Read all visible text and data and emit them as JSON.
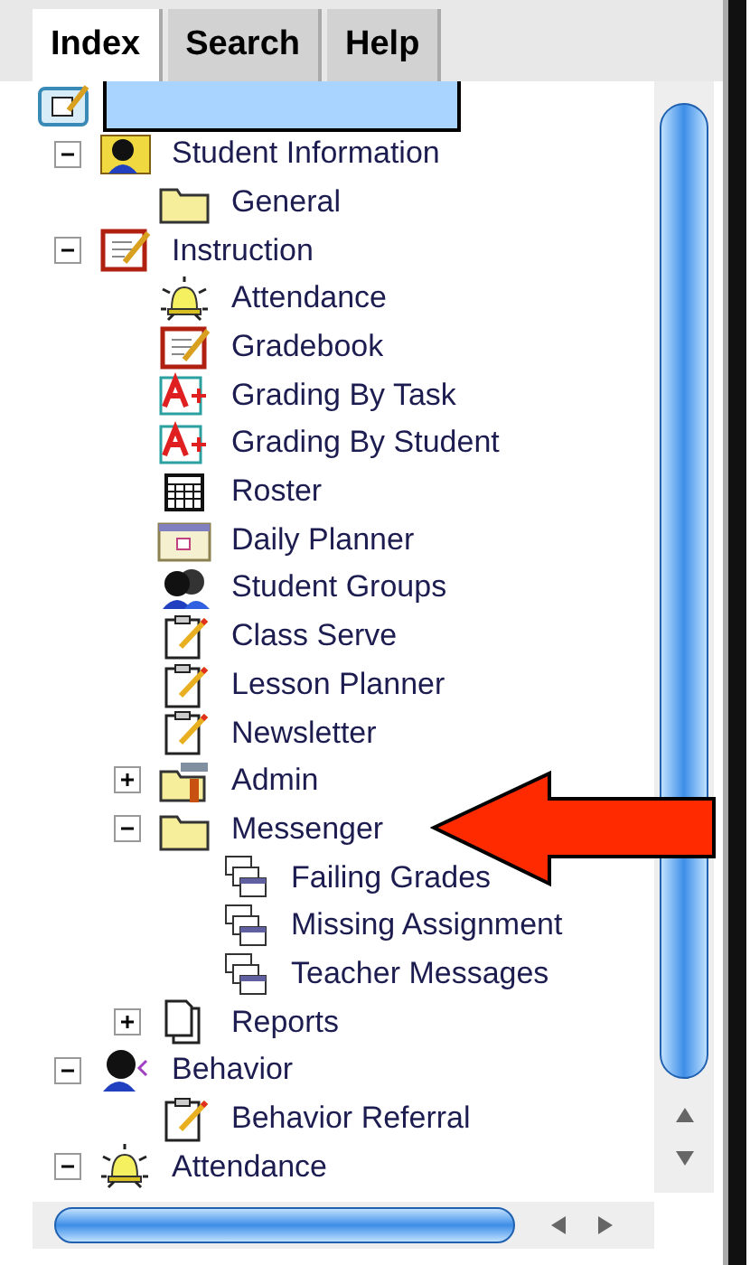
{
  "tabs": [
    {
      "label": "Index",
      "selected": true
    },
    {
      "label": "Search",
      "selected": false
    },
    {
      "label": "Help",
      "selected": false
    }
  ],
  "tree": [
    {
      "kind": "root",
      "children": [
        {
          "label": "Student Information",
          "kind": "student",
          "expanded": true,
          "children": [
            {
              "label": "General",
              "kind": "folder"
            }
          ]
        },
        {
          "label": "Instruction",
          "kind": "notebook",
          "expanded": true,
          "children": [
            {
              "label": "Attendance",
              "kind": "bell"
            },
            {
              "label": "Gradebook",
              "kind": "notebook"
            },
            {
              "label": "Grading By Task",
              "kind": "grade"
            },
            {
              "label": "Grading By Student",
              "kind": "grade"
            },
            {
              "label": "Roster",
              "kind": "grid"
            },
            {
              "label": "Daily Planner",
              "kind": "calendar"
            },
            {
              "label": "Student Groups",
              "kind": "group"
            },
            {
              "label": "Class Serve",
              "kind": "clipboard"
            },
            {
              "label": "Lesson Planner",
              "kind": "clipboard"
            },
            {
              "label": "Newsletter",
              "kind": "clipboard"
            },
            {
              "label": "Admin",
              "kind": "toolfolder",
              "expanded": false
            },
            {
              "label": "Messenger",
              "kind": "folder",
              "expanded": true,
              "children": [
                {
                  "label": "Failing Grades",
                  "kind": "windows"
                },
                {
                  "label": "Missing Assignment",
                  "kind": "windows"
                },
                {
                  "label": "Teacher Messages",
                  "kind": "windows"
                }
              ]
            },
            {
              "label": "Reports",
              "kind": "document",
              "expanded": false
            }
          ]
        },
        {
          "label": "Behavior",
          "kind": "speaker",
          "expanded": true,
          "children": [
            {
              "label": "Behavior Referral",
              "kind": "clipboard"
            }
          ]
        },
        {
          "label": "Attendance",
          "kind": "bell",
          "expanded": true
        }
      ]
    }
  ]
}
